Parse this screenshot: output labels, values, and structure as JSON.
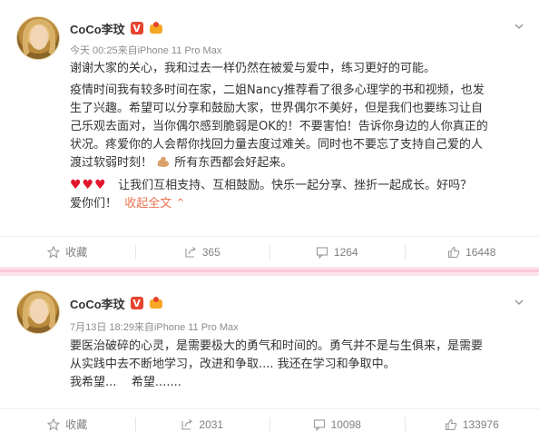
{
  "posts": [
    {
      "author": "CoCo李玟",
      "verified_badge": "V",
      "meta": "今天 00:25来自iPhone 11 Pro Max",
      "paragraphs": [
        "谢谢大家的关心，我和过去一样仍然在被爱与爱中，练习更好的可能。",
        "疫情时间我有较多时间在家，二姐Nancy推荐看了很多心理学的书和视频，也发",
        "生了兴趣。希望可以分享和鼓励大家，世界偶尔不美好，但是我们也要练习让自",
        "己乐观去面对，当你偶尔感到脆弱是OK的！不要害怕！告诉你身边的人你真正的",
        "状况。疼爱你的人会帮你找回力量去度过难关。同时也不要忘了支持自己爱的人",
        "渡过软弱时刻！",
        "所有东西都会好起来。",
        "让我们互相支持、互相鼓励。快乐一起分享、挫折一起成长。好吗？",
        "爱你们！"
      ],
      "hearts": "♥♥♥",
      "collapse_label": "收起全文",
      "actions": {
        "favorite": "收藏",
        "repost": "365",
        "comment": "1264",
        "like": "16448"
      }
    },
    {
      "author": "CoCo李玟",
      "verified_badge": "V",
      "meta": "7月13日 18:29来自iPhone 11 Pro Max",
      "paragraphs": [
        "要医治破碎的心灵，是需要极大的勇气和时间的。勇气并不是与生俱来，是需要",
        "从实践中去不断地学习，改进和争取.... 我还在学习和争取中。",
        "我希望...    希望......."
      ],
      "actions": {
        "favorite": "收藏",
        "repost": "2031",
        "comment": "10098",
        "like": "133976"
      }
    }
  ],
  "colors": {
    "link": "#eb7350",
    "heart": "#e2162c",
    "separator": "#fbe4ea",
    "meta_text": "#8c8c8c"
  }
}
